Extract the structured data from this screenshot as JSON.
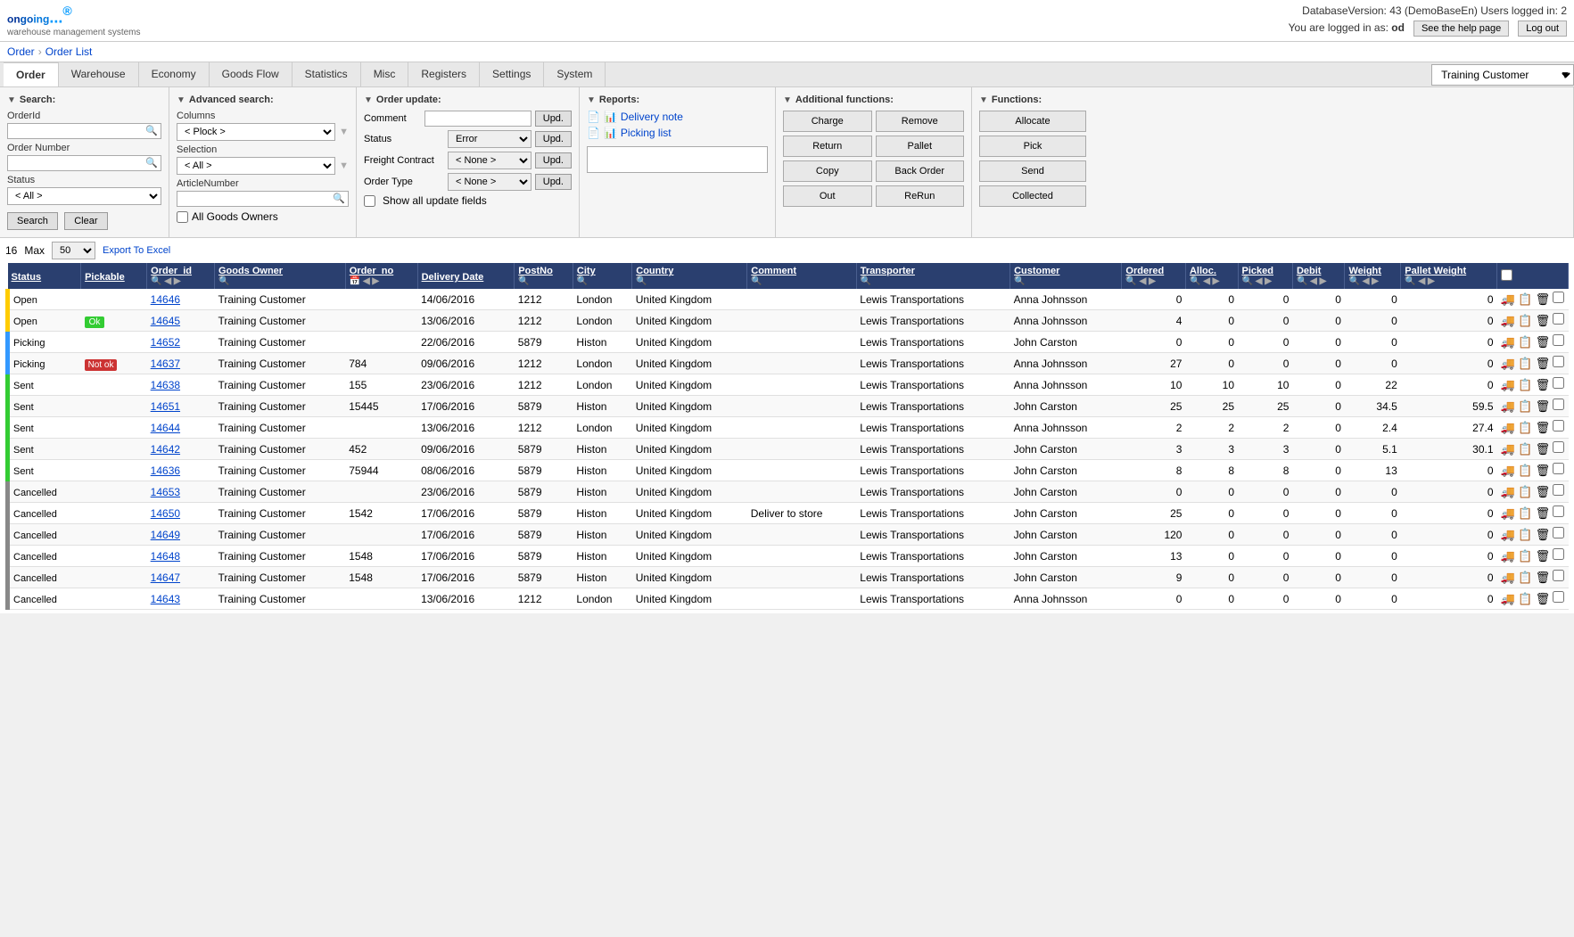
{
  "header": {
    "logo_text": "ongoing",
    "logo_dots": "...",
    "tagline": "warehouse management systems",
    "server_info": "DatabaseVersion: 43 (DemoBaseEn) Users logged in: 2",
    "logged_in_label": "You are logged in as:",
    "logged_in_user": "od",
    "help_link": "See the help page",
    "logout_label": "Log out"
  },
  "breadcrumb": {
    "items": [
      "Order",
      "Order List"
    ]
  },
  "nav": {
    "tabs": [
      "Order",
      "Warehouse",
      "Economy",
      "Goods Flow",
      "Statistics",
      "Misc",
      "Registers",
      "Settings",
      "System"
    ],
    "active": "Order",
    "customer_label": "Training Customer",
    "customer_options": [
      "Training Customer"
    ]
  },
  "search_panel": {
    "title": "Search:",
    "order_id_label": "OrderId",
    "order_number_label": "Order Number",
    "status_label": "Status",
    "status_default": "< All >",
    "search_btn": "Search",
    "clear_btn": "Clear"
  },
  "adv_search_panel": {
    "title": "Advanced search:",
    "columns_label": "Columns",
    "columns_default": "< Plock >",
    "selection_label": "Selection",
    "selection_default": "< All >",
    "article_number_label": "ArticleNumber",
    "all_goods_owners": "All Goods Owners"
  },
  "order_update_panel": {
    "title": "Order update:",
    "comment_label": "Comment",
    "upd_btn": "Upd.",
    "status_label": "Status",
    "status_value": "Error",
    "freight_label": "Freight Contract",
    "freight_default": "< None >",
    "order_type_label": "Order Type",
    "order_type_default": "< None >",
    "show_all_label": "Show all update fields"
  },
  "reports_panel": {
    "title": "Reports:",
    "delivery_note": "Delivery note",
    "picking_list": "Picking list"
  },
  "add_functions_panel": {
    "title": "Additional functions:",
    "buttons": [
      "Charge",
      "Remove",
      "Return",
      "Pallet",
      "Copy",
      "Back Order",
      "Out",
      "ReRun"
    ]
  },
  "functions_panel": {
    "title": "Functions:",
    "buttons": [
      "Allocate",
      "Pick",
      "Send",
      "Collected"
    ]
  },
  "table": {
    "count": "16",
    "max_label": "Max",
    "max_value": "50",
    "export_label": "Export To Excel",
    "columns": [
      "Status",
      "Pickable",
      "Order_id",
      "Goods Owner",
      "Order_no",
      "Delivery Date",
      "PostNo",
      "City",
      "Country",
      "Comment",
      "Transporter",
      "Customer",
      "Ordered",
      "Alloc.",
      "Picked",
      "Debit",
      "Weight",
      "Pallet Weight",
      ""
    ],
    "rows": [
      {
        "status": "Open",
        "status_type": "open",
        "pickable": "",
        "order_id": "14646",
        "goods_owner": "Training Customer",
        "order_no": "",
        "delivery_date": "14/06/2016",
        "postno": "1212",
        "city": "London",
        "country": "United Kingdom",
        "comment": "",
        "transporter": "Lewis Transportations",
        "customer": "Anna Johnsson",
        "ordered": "0",
        "alloc": "0",
        "picked": "0",
        "debit": "0",
        "weight": "0",
        "pallet_weight": "0"
      },
      {
        "status": "Open",
        "status_type": "open",
        "pickable": "Ok",
        "order_id": "14645",
        "goods_owner": "Training Customer",
        "order_no": "",
        "delivery_date": "13/06/2016",
        "postno": "1212",
        "city": "London",
        "country": "United Kingdom",
        "comment": "",
        "transporter": "Lewis Transportations",
        "customer": "Anna Johnsson",
        "ordered": "4",
        "alloc": "0",
        "picked": "0",
        "debit": "0",
        "weight": "0",
        "pallet_weight": "0"
      },
      {
        "status": "Picking",
        "status_type": "picking",
        "pickable": "",
        "order_id": "14652",
        "goods_owner": "Training Customer",
        "order_no": "",
        "delivery_date": "22/06/2016",
        "postno": "5879",
        "city": "Histon",
        "country": "United Kingdom",
        "comment": "",
        "transporter": "Lewis Transportations",
        "customer": "John Carston",
        "ordered": "0",
        "alloc": "0",
        "picked": "0",
        "debit": "0",
        "weight": "0",
        "pallet_weight": "0"
      },
      {
        "status": "Picking",
        "status_type": "picking",
        "pickable": "Not ok",
        "order_id": "14637",
        "goods_owner": "Training Customer",
        "order_no": "784",
        "delivery_date": "09/06/2016",
        "postno": "1212",
        "city": "London",
        "country": "United Kingdom",
        "comment": "",
        "transporter": "Lewis Transportations",
        "customer": "Anna Johnsson",
        "ordered": "27",
        "alloc": "0",
        "picked": "0",
        "debit": "0",
        "weight": "0",
        "pallet_weight": "0"
      },
      {
        "status": "Sent",
        "status_type": "sent",
        "pickable": "",
        "order_id": "14638",
        "goods_owner": "Training Customer",
        "order_no": "155",
        "delivery_date": "23/06/2016",
        "postno": "1212",
        "city": "London",
        "country": "United Kingdom",
        "comment": "",
        "transporter": "Lewis Transportations",
        "customer": "Anna Johnsson",
        "ordered": "10",
        "alloc": "10",
        "picked": "10",
        "debit": "0",
        "weight": "22",
        "pallet_weight": "0"
      },
      {
        "status": "Sent",
        "status_type": "sent",
        "pickable": "",
        "order_id": "14651",
        "goods_owner": "Training Customer",
        "order_no": "15445",
        "delivery_date": "17/06/2016",
        "postno": "5879",
        "city": "Histon",
        "country": "United Kingdom",
        "comment": "",
        "transporter": "Lewis Transportations",
        "customer": "John Carston",
        "ordered": "25",
        "alloc": "25",
        "picked": "25",
        "debit": "0",
        "weight": "34.5",
        "pallet_weight": "59.5"
      },
      {
        "status": "Sent",
        "status_type": "sent",
        "pickable": "",
        "order_id": "14644",
        "goods_owner": "Training Customer",
        "order_no": "",
        "delivery_date": "13/06/2016",
        "postno": "1212",
        "city": "London",
        "country": "United Kingdom",
        "comment": "",
        "transporter": "Lewis Transportations",
        "customer": "Anna Johnsson",
        "ordered": "2",
        "alloc": "2",
        "picked": "2",
        "debit": "0",
        "weight": "2.4",
        "pallet_weight": "27.4"
      },
      {
        "status": "Sent",
        "status_type": "sent",
        "pickable": "",
        "order_id": "14642",
        "goods_owner": "Training Customer",
        "order_no": "452",
        "delivery_date": "09/06/2016",
        "postno": "5879",
        "city": "Histon",
        "country": "United Kingdom",
        "comment": "",
        "transporter": "Lewis Transportations",
        "customer": "John Carston",
        "ordered": "3",
        "alloc": "3",
        "picked": "3",
        "debit": "0",
        "weight": "5.1",
        "pallet_weight": "30.1"
      },
      {
        "status": "Sent",
        "status_type": "sent",
        "pickable": "",
        "order_id": "14636",
        "goods_owner": "Training Customer",
        "order_no": "75944",
        "delivery_date": "08/06/2016",
        "postno": "5879",
        "city": "Histon",
        "country": "United Kingdom",
        "comment": "",
        "transporter": "Lewis Transportations",
        "customer": "John Carston",
        "ordered": "8",
        "alloc": "8",
        "picked": "8",
        "debit": "0",
        "weight": "13",
        "pallet_weight": "0"
      },
      {
        "status": "Cancelled",
        "status_type": "cancelled",
        "pickable": "",
        "order_id": "14653",
        "goods_owner": "Training Customer",
        "order_no": "",
        "delivery_date": "23/06/2016",
        "postno": "5879",
        "city": "Histon",
        "country": "United Kingdom",
        "comment": "",
        "transporter": "Lewis Transportations",
        "customer": "John Carston",
        "ordered": "0",
        "alloc": "0",
        "picked": "0",
        "debit": "0",
        "weight": "0",
        "pallet_weight": "0"
      },
      {
        "status": "Cancelled",
        "status_type": "cancelled",
        "pickable": "",
        "order_id": "14650",
        "goods_owner": "Training Customer",
        "order_no": "1542",
        "delivery_date": "17/06/2016",
        "postno": "5879",
        "city": "Histon",
        "country": "United Kingdom",
        "comment": "Deliver to store",
        "transporter": "Lewis Transportations",
        "customer": "John Carston",
        "ordered": "25",
        "alloc": "0",
        "picked": "0",
        "debit": "0",
        "weight": "0",
        "pallet_weight": "0"
      },
      {
        "status": "Cancelled",
        "status_type": "cancelled",
        "pickable": "",
        "order_id": "14649",
        "goods_owner": "Training Customer",
        "order_no": "",
        "delivery_date": "17/06/2016",
        "postno": "5879",
        "city": "Histon",
        "country": "United Kingdom",
        "comment": "",
        "transporter": "Lewis Transportations",
        "customer": "John Carston",
        "ordered": "120",
        "alloc": "0",
        "picked": "0",
        "debit": "0",
        "weight": "0",
        "pallet_weight": "0"
      },
      {
        "status": "Cancelled",
        "status_type": "cancelled",
        "pickable": "",
        "order_id": "14648",
        "goods_owner": "Training Customer",
        "order_no": "1548",
        "delivery_date": "17/06/2016",
        "postno": "5879",
        "city": "Histon",
        "country": "United Kingdom",
        "comment": "",
        "transporter": "Lewis Transportations",
        "customer": "John Carston",
        "ordered": "13",
        "alloc": "0",
        "picked": "0",
        "debit": "0",
        "weight": "0",
        "pallet_weight": "0"
      },
      {
        "status": "Cancelled",
        "status_type": "cancelled",
        "pickable": "",
        "order_id": "14647",
        "goods_owner": "Training Customer",
        "order_no": "1548",
        "delivery_date": "17/06/2016",
        "postno": "5879",
        "city": "Histon",
        "country": "United Kingdom",
        "comment": "",
        "transporter": "Lewis Transportations",
        "customer": "John Carston",
        "ordered": "9",
        "alloc": "0",
        "picked": "0",
        "debit": "0",
        "weight": "0",
        "pallet_weight": "0"
      },
      {
        "status": "Cancelled",
        "status_type": "cancelled",
        "pickable": "",
        "order_id": "14643",
        "goods_owner": "Training Customer",
        "order_no": "",
        "delivery_date": "13/06/2016",
        "postno": "1212",
        "city": "London",
        "country": "United Kingdom",
        "comment": "",
        "transporter": "Lewis Transportations",
        "customer": "Anna Johnsson",
        "ordered": "0",
        "alloc": "0",
        "picked": "0",
        "debit": "0",
        "weight": "0",
        "pallet_weight": "0"
      }
    ]
  }
}
